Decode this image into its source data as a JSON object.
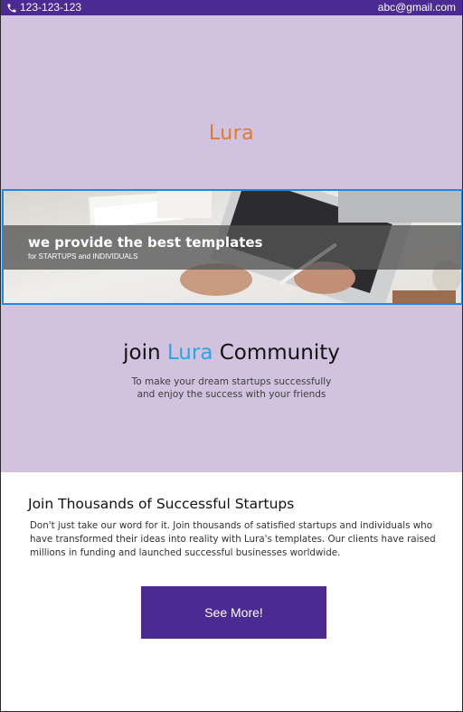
{
  "topbar": {
    "phone": "123-123-123",
    "email": "abc@gmail.com",
    "phone_icon": "phone-icon"
  },
  "hero": {
    "brand": "Lura",
    "banner": {
      "title": "we provide the best templates",
      "subtitle": "for STARTUPS and INDIVIDUALS"
    },
    "join": {
      "prefix": "join",
      "accent": "Lura",
      "suffix": "Community",
      "line1": "To make your dream startups successfully",
      "line2": "and enjoy the success with your friends"
    }
  },
  "content": {
    "heading": "Join Thousands of Successful Startups",
    "body": "Don't just take our word for it. Join thousands of satisfied startups and individuals who have transformed their ideas into reality with Lura's templates. Our clients have raised millions in funding and launched successful businesses worldwide.",
    "cta_label": "See More!"
  },
  "colors": {
    "topbar_bg": "#4b2a93",
    "hero_bg": "#d1c3e0",
    "brand": "#e07a2e",
    "accent": "#2aa5ea",
    "banner_border": "#1e88e5",
    "cta_bg": "#4b2a93"
  }
}
